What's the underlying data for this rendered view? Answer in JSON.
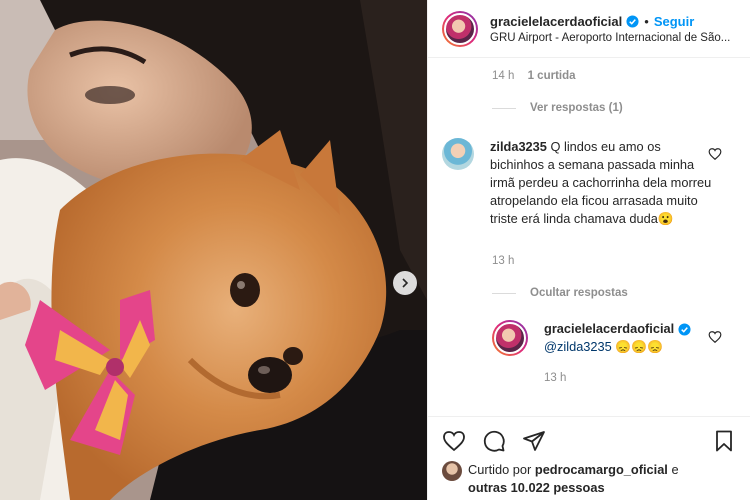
{
  "post": {
    "author": "gracielelacerdaoficial",
    "follow_label": "Seguir",
    "separator": "•",
    "location": "GRU Airport - Aeroporto Internacional de São..."
  },
  "prev_comment": {
    "time": "14 h",
    "likes": "1 curtida",
    "view_replies": "Ver respostas (1)"
  },
  "comment": {
    "username": "zilda3235",
    "text": "Q lindos eu amo os bichinhos a semana passada minha irmã perdeu a cachorrinha dela morreu atropelando ela ficou arrasada muito triste erá linda chamava duda😮",
    "time": "13 h",
    "hide_replies": "Ocultar respostas"
  },
  "reply": {
    "username": "gracielelacerdaoficial",
    "mention": "@zilda3235",
    "emojis": "😞😞😞",
    "time": "13 h"
  },
  "footer": {
    "liked_prefix": "Curtido por",
    "liked_user": "pedrocamargo_oficial",
    "liked_and": "e",
    "liked_others": "outras 10.022 pessoas"
  },
  "colors": {
    "accent": "#0095f6",
    "muted": "#8e8e8e",
    "text": "#262626"
  },
  "icons": [
    "chevron-right-icon",
    "verified-badge-icon",
    "heart-icon",
    "comment-icon",
    "share-icon",
    "save-icon"
  ]
}
